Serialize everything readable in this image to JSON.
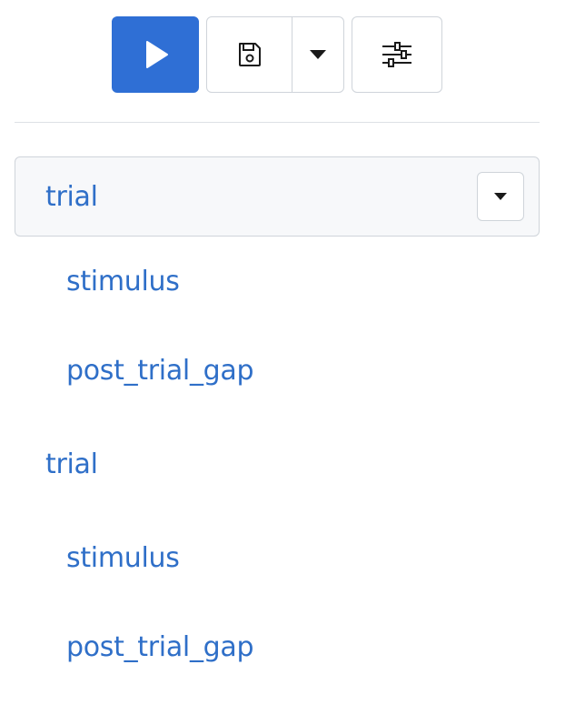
{
  "toolbar": {
    "run_icon": "play-icon",
    "save_icon": "save-icon",
    "save_menu_icon": "caret-down-icon",
    "settings_icon": "sliders-icon",
    "accent_color": "#2f6fd5"
  },
  "tree": {
    "items": [
      {
        "label": "trial",
        "level": 0,
        "selected": true
      },
      {
        "label": "stimulus",
        "level": 1
      },
      {
        "label": "post_trial_gap",
        "level": 1
      },
      {
        "label": "trial",
        "level": 0
      },
      {
        "label": "stimulus",
        "level": 1
      },
      {
        "label": "post_trial_gap",
        "level": 1
      }
    ],
    "item_menu_icon": "caret-down-icon",
    "link_color": "#2f6fc8"
  }
}
